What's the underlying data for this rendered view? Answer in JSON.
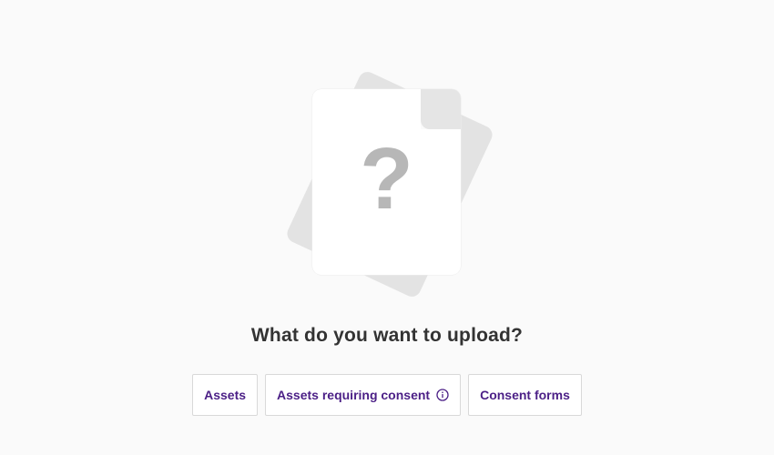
{
  "illustration": {
    "symbol": "?"
  },
  "prompt": {
    "title": "What do you want to upload?"
  },
  "options": [
    {
      "label": "Assets"
    },
    {
      "label": "Assets requiring consent",
      "icon": "info-icon"
    },
    {
      "label": "Consent forms"
    }
  ],
  "colors": {
    "background": "#fafafa",
    "accent": "#4b1f86",
    "border": "#d9d9d9",
    "heading": "#333333",
    "placeholder": "#b7b7b7"
  }
}
